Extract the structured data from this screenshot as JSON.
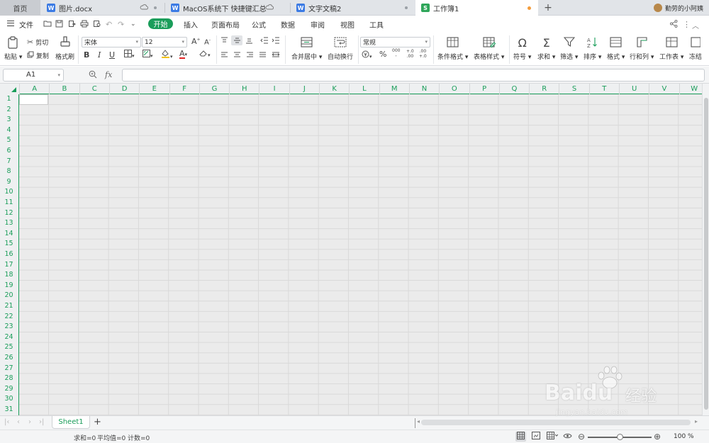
{
  "tabs": {
    "home": "首页",
    "items": [
      {
        "label": "图片.docx",
        "type": "w"
      },
      {
        "label": "MacOS系统下 快捷键汇总",
        "type": "w"
      },
      {
        "label": "文字文稿2",
        "type": "w"
      },
      {
        "label": "工作簿1",
        "type": "s"
      }
    ],
    "add_label": "+",
    "user": "勤劳的小阿姨"
  },
  "menu": {
    "file": "文件",
    "items": [
      "开始",
      "插入",
      "页面布局",
      "公式",
      "数据",
      "审阅",
      "视图",
      "工具"
    ]
  },
  "ribbon": {
    "paste": "粘贴",
    "cut": "剪切",
    "copy": "复制",
    "format_painter": "格式刷",
    "font_name": "宋体",
    "font_size": "12",
    "bold": "B",
    "italic": "I",
    "underline": "U",
    "merge_center": "合并居中",
    "auto_wrap": "自动换行",
    "number_format": "常规",
    "percent": "%",
    "cond_format": "条件格式",
    "table_style": "表格样式",
    "symbol": "符号",
    "sum": "求和",
    "filter": "筛选",
    "sort": "排序",
    "format": "格式",
    "row_col": "行和列",
    "worksheet": "工作表",
    "freeze": "冻结"
  },
  "formula_bar": {
    "cell_ref": "A1",
    "fx": "fx"
  },
  "grid": {
    "columns": [
      "A",
      "B",
      "C",
      "D",
      "E",
      "F",
      "G",
      "H",
      "I",
      "J",
      "K",
      "L",
      "M",
      "N",
      "O",
      "P",
      "Q",
      "R",
      "S",
      "T",
      "U",
      "V",
      "W"
    ],
    "rows": [
      "1",
      "2",
      "3",
      "4",
      "5",
      "6",
      "7",
      "8",
      "9",
      "10",
      "11",
      "12",
      "13",
      "14",
      "15",
      "16",
      "17",
      "18",
      "19",
      "20",
      "21",
      "22",
      "23",
      "24",
      "25",
      "26",
      "27",
      "28",
      "29",
      "30",
      "31"
    ]
  },
  "sheets": {
    "names": [
      "Sheet1"
    ],
    "add_label": "+"
  },
  "status": {
    "sum": "求和=0",
    "avg": "平均值=0",
    "count": "计数=0",
    "zoom": "100 %",
    "zoom_percent": 100
  },
  "watermark": {
    "brand": "Baidu",
    "cn": "经验",
    "url": "jingyan.baidu.com"
  }
}
